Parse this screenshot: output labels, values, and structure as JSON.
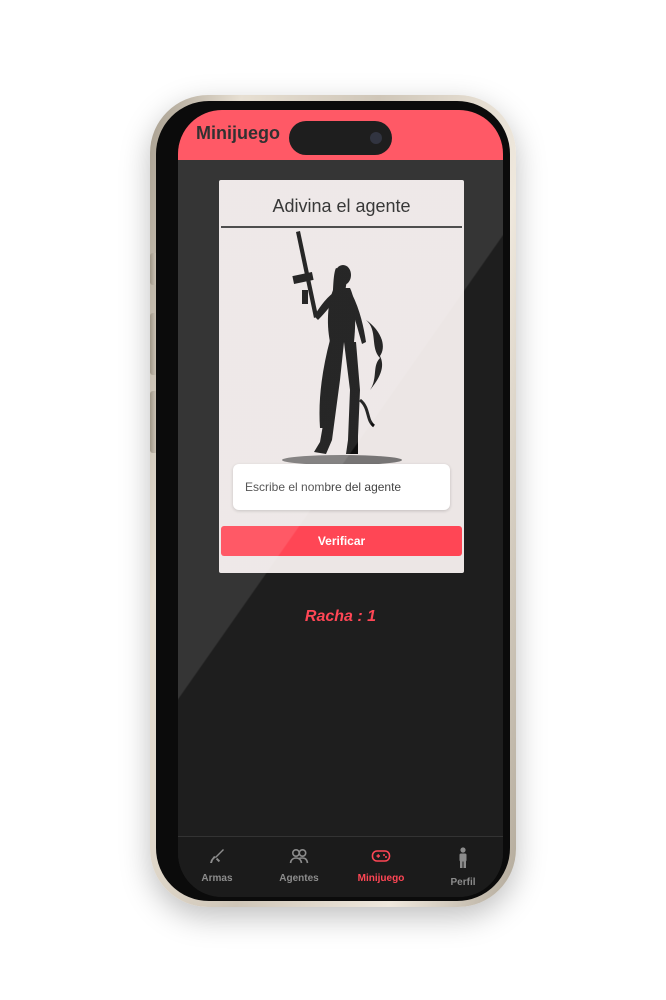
{
  "header": {
    "title": "Minijuego"
  },
  "card": {
    "title": "Adivina el agente",
    "input_placeholder": "Escribe el nombre del agente",
    "input_value": "",
    "verify_label": "Verificar"
  },
  "streak_text": "Racha : 1",
  "tabs": [
    {
      "label": "Armas",
      "icon": "weapon-icon",
      "active": false
    },
    {
      "label": "Agentes",
      "icon": "agents-icon",
      "active": false
    },
    {
      "label": "Minijuego",
      "icon": "gamepad-icon",
      "active": true
    },
    {
      "label": "Perfil",
      "icon": "person-icon",
      "active": false
    }
  ],
  "colors": {
    "accent": "#ff4655",
    "background": "#1e1e1e",
    "card": "#ece6e5"
  }
}
